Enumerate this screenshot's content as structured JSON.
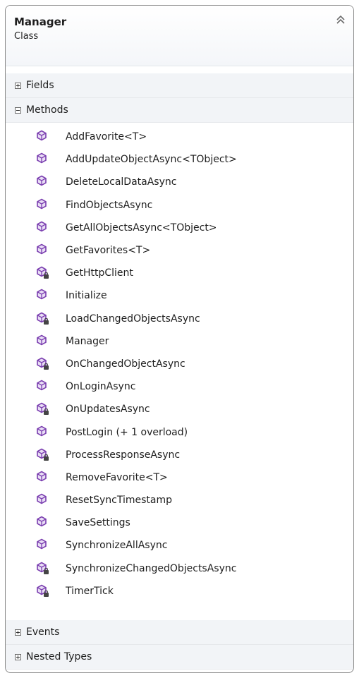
{
  "header": {
    "title": "Manager",
    "subtitle": "Class",
    "collapse_icon": "double-chevron-up-icon"
  },
  "sections": {
    "fields": {
      "label": "Fields",
      "state": "collapsed"
    },
    "methods": {
      "label": "Methods",
      "state": "expanded"
    },
    "events": {
      "label": "Events",
      "state": "collapsed"
    },
    "nested_types": {
      "label": "Nested Types",
      "state": "collapsed"
    }
  },
  "methods": [
    {
      "name": "AddFavorite<T>",
      "access": "public"
    },
    {
      "name": "AddUpdateObjectAsync<TObject>",
      "access": "public"
    },
    {
      "name": "DeleteLocalDataAsync",
      "access": "public"
    },
    {
      "name": "FindObjectsAsync",
      "access": "public"
    },
    {
      "name": "GetAllObjectsAsync<TObject>",
      "access": "public"
    },
    {
      "name": "GetFavorites<T>",
      "access": "public"
    },
    {
      "name": "GetHttpClient",
      "access": "private"
    },
    {
      "name": "Initialize",
      "access": "public"
    },
    {
      "name": "LoadChangedObjectsAsync",
      "access": "private"
    },
    {
      "name": "Manager",
      "access": "public"
    },
    {
      "name": "OnChangedObjectAsync",
      "access": "private"
    },
    {
      "name": "OnLoginAsync",
      "access": "public"
    },
    {
      "name": "OnUpdatesAsync",
      "access": "private"
    },
    {
      "name": "PostLogin (+ 1 overload)",
      "access": "public"
    },
    {
      "name": "ProcessResponseAsync",
      "access": "private"
    },
    {
      "name": "RemoveFavorite<T>",
      "access": "public"
    },
    {
      "name": "ResetSyncTimestamp",
      "access": "public"
    },
    {
      "name": "SaveSettings",
      "access": "public"
    },
    {
      "name": "SynchronizeAllAsync",
      "access": "public"
    },
    {
      "name": "SynchronizeChangedObjectsAsync",
      "access": "private"
    },
    {
      "name": "TimerTick",
      "access": "private"
    }
  ],
  "icons": {
    "method": "method-cube-icon",
    "private_overlay": "lock-icon"
  },
  "colors": {
    "method_icon": "#7b3fb0",
    "border": "#8a8a8a",
    "section_bg": "#f2f4f7"
  }
}
